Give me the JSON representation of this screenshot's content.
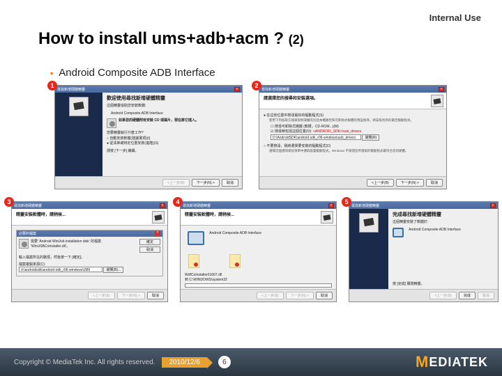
{
  "classification": "Internal Use",
  "title_main": "How to install ums+adb+acm ?",
  "title_sub": "(2)",
  "bullet1": "Android Composite ADB Interface",
  "wizard_window_title": "尋找新增硬體精靈",
  "shot1": {
    "heading": "歡迎使用尋找新增硬體精靈",
    "line1": "這個精靈協助您安裝軟體:",
    "device": "Android Composite ADB Interface",
    "cd_hint": "如果您的硬體附有安裝 CD 或磁片，現在將它插入。",
    "q": "您要精靈執行什麼工作?",
    "opt1": "自動安裝軟體(建議選項)(I)",
    "opt2": "從清單或特定位置安裝(進階)(S)",
    "cont": "請按 [下一步] 繼續。",
    "back": "<上一步(B)",
    "next": "下一步(N) >",
    "cancel": "取消"
  },
  "shot2": {
    "heading": "請選擇您的搜尋和安裝選項。",
    "opt1": "在這些位置中搜尋最好的驅動程式(S)",
    "opt1_desc": "使用下列核取方塊來限制或擴充包括本機路徑和可卸除式媒體的預設搜尋。將安裝找到的最佳驅動程式。",
    "chk1": "搜尋可卸除式媒體 (軟碟，CD-ROM...)(M)",
    "chk2": "搜尋時包括這個位置(O):",
    "path_hint": "<ANDROID_SDK>\\usb_drivers",
    "path_value": "D:\\AndroidSDK\\android-sdk_r06-windows\\usb_drivers",
    "browse": "瀏覽(R)",
    "opt2": "不要搜尋，我將選擇要安裝的驅動程式(D)",
    "opt2_desc": "選擇這個選項來從清單中選取裝置驅動程式。Windows 不保證您所選取的驅動程式最符合您的硬體。",
    "back": "<上一步(B)",
    "next": "下一步(N) >",
    "cancel": "取消"
  },
  "shot3": {
    "heading": "精靈安裝軟體時，請稍候...",
    "box_title": "必要的檔案",
    "need": "需要 'Android WinUsb installation disk' 的檔案 'WinUSBCoInstaller.dll'。",
    "ok": "確定",
    "cancel_btn": "取消",
    "hint": "輸入檔案所在的路徑，然後按一下 [確定]。",
    "copy_from": "檔案複製來源(C):",
    "path": "d:\\androidsdk\\android-sdk_r06-windows\\i386",
    "browse": "瀏覽(B)...",
    "back": "<上一步(B)",
    "next": "下一步(N) >",
    "cancel": "取消"
  },
  "shot4": {
    "heading": "精靈安裝軟體時，請稍候...",
    "device": "Android Composite ADB Interface",
    "file": "WdfCoInstaller01007.dll",
    "dest": "到 C:\\WINDOWS\\system32",
    "back": "<上一步(B)",
    "next": "下一步(N) >",
    "cancel": "取消"
  },
  "shot5": {
    "heading": "完成尋找新增硬體精靈",
    "done": "這個精靈安裝了軟體於:",
    "device": "Android Composite ADB Interface",
    "close_hint": "按 [完成] 關閉精靈。",
    "back": "<上一步(B)",
    "finish": "完成",
    "cancel": "取消"
  },
  "footer": {
    "copyright": "Copyright © MediaTek Inc. All rights reserved.",
    "date": "2010/12/6",
    "page": "6",
    "logo_text": "EDIATEK"
  }
}
